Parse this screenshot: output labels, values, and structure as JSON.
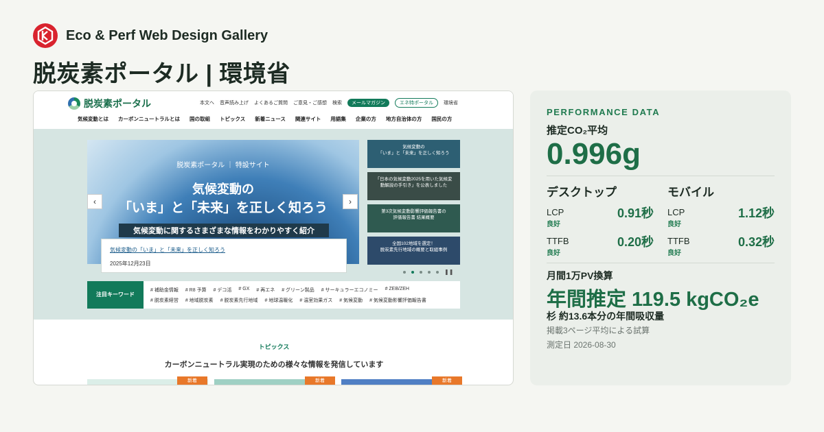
{
  "brand": {
    "name": "Eco & Perf Web Design Gallery"
  },
  "page_title": "脱炭素ポータル | 環境省",
  "site": {
    "logo_text": "脱炭素ポータル",
    "utility": [
      "本文へ",
      "音声読み上げ",
      "よくあるご質問",
      "ご意見・ご感想",
      "検索"
    ],
    "pill_mail": "メールマガジン",
    "pill_eco": "エネ特ポータル",
    "ministry": "環境省",
    "gnav": [
      "気候変動とは",
      "カーボンニュートラルとは",
      "国の取組",
      "トピックス",
      "新着ニュース",
      "関連サイト",
      "用語集",
      "企業の方",
      "地方自治体の方",
      "国民の方"
    ],
    "hero": {
      "sub": "脱炭素ポータル ｜ 特設サイト",
      "h1": "気候変動の",
      "h2": "「いま」と「未来」を正しく知ろう",
      "band": "気候変動に関するさまざまな情報をわかりやすく紹介",
      "card_title": "気候変動の「いま」と「未来」を正しく知ろう",
      "card_date": "2025年12月23日"
    },
    "side": [
      "気候変動の\n「いま」と「未来」を正しく知ろう",
      "「日本の気候変動2025を用いた気候変\n動解説の手引き」を公表しました",
      "第3次気候変動影響評価報告書の\n評価報告書 結果概要",
      "全国102地域を選定！\n脱炭素先行地域の概要と取組事例"
    ],
    "keyword_label": "注目キーワード",
    "keywords_row1": [
      "# 補助金情報",
      "# R8 予算",
      "# デコ活",
      "# GX",
      "# 再エネ",
      "# グリーン製品",
      "# サーキュラーエコノミー",
      "# ZEB/ZEH"
    ],
    "keywords_row2": [
      "# 脱炭素経営",
      "# 地域脱炭素",
      "# 脱炭素先行地域",
      "# 地球温暖化",
      "# 温室効果ガス",
      "# 気候変動",
      "# 気候変動影響評価報告書"
    ],
    "topics_label": "トピックス",
    "topics_title": "カーボンニュートラル実現のための様々な情報を発信しています",
    "new_badge": "新着"
  },
  "perf": {
    "heading": "PERFORMANCE DATA",
    "co2_label": "推定CO₂平均",
    "co2_value": "0.996g",
    "desktop_title": "デスクトップ",
    "mobile_title": "モバイル",
    "desktop": {
      "lcp_label": "LCP",
      "lcp_value": "0.91秒",
      "lcp_status": "良好",
      "ttfb_label": "TTFB",
      "ttfb_value": "0.20秒",
      "ttfb_status": "良好"
    },
    "mobile": {
      "lcp_label": "LCP",
      "lcp_value": "1.12秒",
      "lcp_status": "良好",
      "ttfb_label": "TTFB",
      "ttfb_value": "0.32秒",
      "ttfb_status": "良好"
    },
    "pv_label": "月間1万PV換算",
    "annual": "年間推定 119.5 kgCO₂e",
    "tree": "杉 約13.6本分の年間吸収量",
    "note": "掲載3ページ平均による試算",
    "measured": "測定日 2026-08-30"
  },
  "colors": {
    "accent": "#1e6e47",
    "brand_red": "#d9232e",
    "site_green": "#127a5a"
  }
}
